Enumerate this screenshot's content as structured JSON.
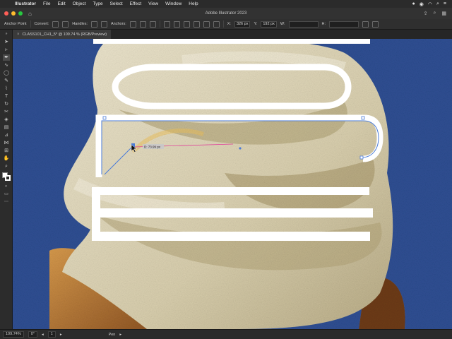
{
  "menubar": {
    "app_name": "Illustrator",
    "items": [
      "File",
      "Edit",
      "Object",
      "Type",
      "Select",
      "Effect",
      "View",
      "Window",
      "Help"
    ]
  },
  "window": {
    "title": "Adobe Illustrator 2023"
  },
  "control_bar": {
    "context_label": "Anchor Point",
    "convert_label": "Convert:",
    "handles_label": "Handles:",
    "anchors_label": "Anchors:",
    "x_label": "X:",
    "x_value": "326 px",
    "y_label": "Y:",
    "y_value": "192 px",
    "w_label": "W:",
    "h_label": "H:"
  },
  "document_tab": {
    "label": "CLASS101_CH1_5* @ 109.74 % (RGB/Preview)"
  },
  "canvas": {
    "measure_tooltip": "D: 73.99 px"
  },
  "status_bar": {
    "zoom": "109.74%",
    "rotation": "0°",
    "artboard": "1",
    "tool_name": "Pen"
  },
  "colors": {
    "background_blue": "#2f4f93",
    "shape_stroke": "#ffffff",
    "path_highlight": "#4a7bd8",
    "guide_magenta": "#e0409a"
  }
}
